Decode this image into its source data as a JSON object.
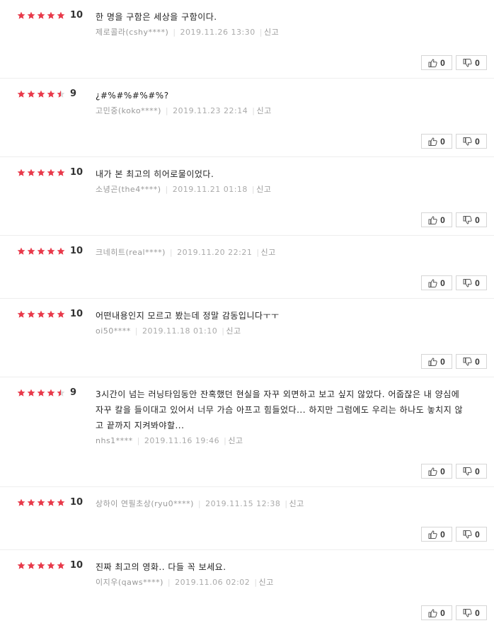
{
  "colors": {
    "star": "#e8394a",
    "star_empty": "#d9d9d9"
  },
  "labels": {
    "report": "신고"
  },
  "reviews": [
    {
      "score": "10",
      "stars": 5,
      "text": "한 명을 구함은 세상을 구함이다.",
      "user": "제로콜라(cshy****)",
      "date": "2019.11.26 13:30",
      "likes": "0",
      "dislikes": "0"
    },
    {
      "score": "9",
      "stars": 4.5,
      "text": "¿#%#%#%#%?",
      "user": "고민중(koko****)",
      "date": "2019.11.23 22:14",
      "likes": "0",
      "dislikes": "0"
    },
    {
      "score": "10",
      "stars": 5,
      "text": "내가 본 최고의 히어로물이었다.",
      "user": "소녕곤(the4****)",
      "date": "2019.11.21 01:18",
      "likes": "0",
      "dislikes": "0"
    },
    {
      "score": "10",
      "stars": 5,
      "text": "",
      "user": "크네히트(real****)",
      "date": "2019.11.20 22:21",
      "likes": "0",
      "dislikes": "0"
    },
    {
      "score": "10",
      "stars": 5,
      "text": "어떤내용인지 모르고 봤는데 정말 감동입니다ㅜㅜ",
      "user": "oi50****",
      "date": "2019.11.18 01:10",
      "likes": "0",
      "dislikes": "0"
    },
    {
      "score": "9",
      "stars": 4.5,
      "text": "3시간이 넘는 러닝타임동안 잔혹했던 현실을 자꾸 외면하고 보고 싶지 않았다. 어줍잖은 내 양심에 자꾸 칼을 들이대고 있어서 너무 가슴 아프고 힘들었다... 하지만 그럼에도 우리는 하나도 놓치지 않고 끝까지 지켜봐야할...",
      "user": "nhs1****",
      "date": "2019.11.16 19:46",
      "likes": "0",
      "dislikes": "0"
    },
    {
      "score": "10",
      "stars": 5,
      "text": "",
      "user": "상하이 연필초상(ryu0****)",
      "date": "2019.11.15 12:38",
      "likes": "0",
      "dislikes": "0"
    },
    {
      "score": "10",
      "stars": 5,
      "text": "진짜 최고의 영화.. 다들 꼭 보세요.",
      "user": "이지우(qaws****)",
      "date": "2019.11.06 02:02",
      "likes": "0",
      "dislikes": "0"
    }
  ]
}
